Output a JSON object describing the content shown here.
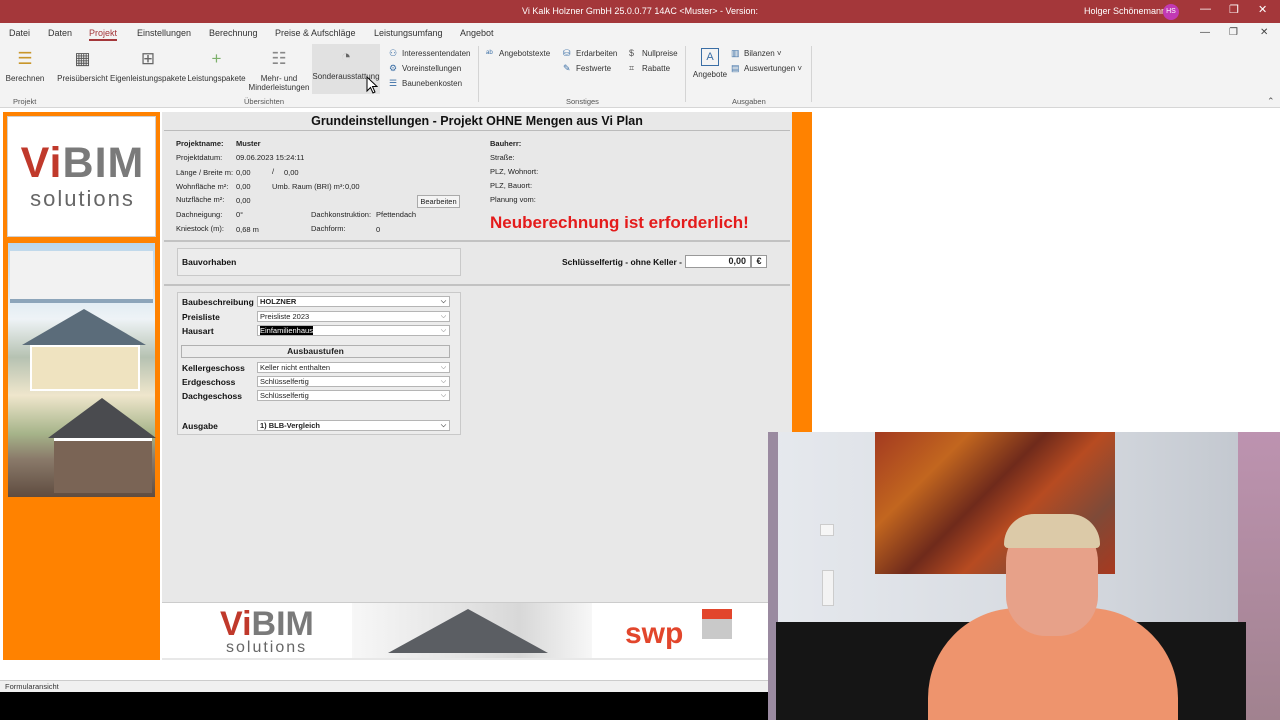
{
  "window": {
    "title": "Vi Kalk Holzner GmbH 25.0.0.77 14AC   <Muster> - Version:",
    "user": "Holger Schönemann",
    "user_initials": "HS",
    "minimize": "—",
    "restore": "❐",
    "close": "✕"
  },
  "menu": {
    "items": [
      "Datei",
      "Daten",
      "Projekt",
      "Einstellungen",
      "Berechnung",
      "Preise & Aufschläge",
      "Leistungsumfang",
      "Angebot"
    ],
    "active": "Projekt",
    "controls": {
      "minimize": "—",
      "restore": "❐",
      "close": "✕"
    }
  },
  "ribbon": {
    "berechnen": "Berechnen",
    "preisuebersicht": "Preisübersicht",
    "eigenleistungspakete": "Eigenleistungspakete",
    "leistungspakete": "Leistungspakete",
    "mehr_minder": "Mehr- und",
    "mehr_minder2": "Minderleistungen",
    "sonderausstattung": "Sonderausstattung",
    "interessentendaten": "Interessentendaten",
    "voreinstellungen": "Voreinstellungen",
    "baunebenkosten": "Baunebenkosten",
    "angebotstexte": "Angebotstexte",
    "erdarbeiten": "Erdarbeiten",
    "festwerte": "Festwerte",
    "nullpreise": "Nullpreise",
    "rabatte": "Rabatte",
    "angebote": "Angebote",
    "bilanzen": "Bilanzen ˅",
    "auswertungen": "Auswertungen ˅",
    "groups": {
      "projekt": "Projekt",
      "uebersichten": "Übersichten",
      "sonstiges": "Sonstiges",
      "ausgaben": "Ausgaben"
    },
    "icons": {
      "berechnen": "database-stack-icon",
      "preisuebersicht": "calculator-icon",
      "eigenleistungspakete": "grid-table-icon",
      "leistungspakete": "plus-icon",
      "mehr_minder": "list-lines-icon",
      "sonderausstattung": "palette-icon"
    }
  },
  "logo": {
    "vi": "Vi",
    "bim": "BIM",
    "solutions": "solutions"
  },
  "form": {
    "title": "Grundeinstellungen - Projekt OHNE Mengen aus Vi Plan",
    "projektname_label": "Projektname:",
    "projektname_value": "Muster",
    "projektdatum_label": "Projektdatum:",
    "projektdatum_value": "09.06.2023 15:24:11",
    "laenge_label": "Länge / Breite m:",
    "laenge_value": "0,00",
    "slash": "/",
    "breite_value": "0,00",
    "wohnflaeche_label": "Wohnfläche m²:",
    "wohnflaeche_value": "0,00",
    "umb_label": "Umb. Raum (BRI) m³:",
    "umb_value": "0,00",
    "nutzflaeche_label": "Nutzfläche m²:",
    "nutzflaeche_value": "0,00",
    "bearbeiten": "Bearbeiten",
    "dachneigung_label": "Dachneigung:",
    "dachneigung_value": "0°",
    "dachkonstruktion_label": "Dachkonstruktion:",
    "dachkonstruktion_value": "Pfettendach",
    "kniestock_label": "Kniestock (m):",
    "kniestock_value": "0,68 m",
    "dachform_label": "Dachform:",
    "dachform_value": "0",
    "bauherr_label": "Bauherr:",
    "strasse_label": "Straße:",
    "plz_wohnort_label": "PLZ, Wohnort:",
    "plz_bauort_label": "PLZ, Bauort:",
    "planung_label": "Planung vom:",
    "warning": "Neuberechnung ist erforderlich!",
    "bauvorhaben": "Bauvorhaben",
    "schluessel_label": "Schlüsselfertig - ohne Keller -",
    "schluessel_value": "0,00",
    "currency": "€",
    "baubeschreibung_label": "Baubeschreibung",
    "baubeschreibung_value": "HOLZNER",
    "preisliste_label": "Preisliste",
    "preisliste_value": "Preisliste 2023",
    "hausart_label": "Hausart",
    "hausart_value": "Einfamilienhaus",
    "ausbaustufen": "Ausbaustufen",
    "kellergeschoss_label": "Kellergeschoss",
    "kellergeschoss_value": "Keller nicht enthalten",
    "erdgeschoss_label": "Erdgeschoss",
    "erdgeschoss_value": "Schlüsselfertig",
    "dachgeschoss_label": "Dachgeschoss",
    "dachgeschoss_value": "Schlüsselfertig",
    "ausgabe_label": "Ausgabe",
    "ausgabe_value": "1) BLB-Vergleich",
    "dropdown_glyph": "⌵"
  },
  "banner": {
    "vi": "Vi",
    "bim": "BIM",
    "solutions": "solutions",
    "swp": "swp"
  },
  "status": {
    "view": "Formularansicht"
  },
  "colors": {
    "titlebar": "#a4373a",
    "accent_orange": "#ff8200",
    "warning_red": "#e41b1b",
    "avatar": "#c239b3"
  }
}
